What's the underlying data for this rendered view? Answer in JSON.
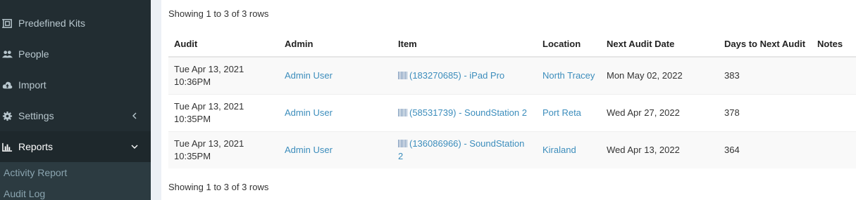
{
  "sidebar": {
    "items": [
      {
        "label": "Predefined Kits",
        "icon": "predefined-kits-icon"
      },
      {
        "label": "People",
        "icon": "users-icon"
      },
      {
        "label": "Import",
        "icon": "cloud-upload-icon"
      },
      {
        "label": "Settings",
        "icon": "gear-icon"
      },
      {
        "label": "Reports",
        "icon": "bar-chart-icon"
      }
    ],
    "submenu": [
      {
        "label": "Activity Report"
      },
      {
        "label": "Audit Log"
      }
    ]
  },
  "table": {
    "pagination_top": "Showing 1 to 3 of 3 rows",
    "pagination_bottom": "Showing 1 to 3 of 3 rows",
    "columns": [
      "Audit",
      "Admin",
      "Item",
      "Location",
      "Next Audit Date",
      "Days to Next Audit",
      "Notes"
    ],
    "rows": [
      {
        "audit_date": "Tue Apr 13, 2021",
        "audit_time": "10:36PM",
        "admin": "Admin User",
        "item": "(183270685) - iPad Pro",
        "location": "North Tracey",
        "next_audit": "Mon May 02, 2022",
        "days": "383",
        "notes": ""
      },
      {
        "audit_date": "Tue Apr 13, 2021",
        "audit_time": "10:35PM",
        "admin": "Admin User",
        "item": "(58531739) - SoundStation 2",
        "location": "Port Reta",
        "next_audit": "Wed Apr 27, 2022",
        "days": "378",
        "notes": ""
      },
      {
        "audit_date": "Tue Apr 13, 2021",
        "audit_time": "10:35PM",
        "admin": "Admin User",
        "item": "(136086966) - SoundStation 2",
        "location": "Kiraland",
        "next_audit": "Wed Apr 13, 2022",
        "days": "364",
        "notes": ""
      }
    ]
  },
  "colors": {
    "sidebar_bg": "#222d32",
    "link": "#3c8dbc",
    "active_bg": "#1e282c"
  }
}
